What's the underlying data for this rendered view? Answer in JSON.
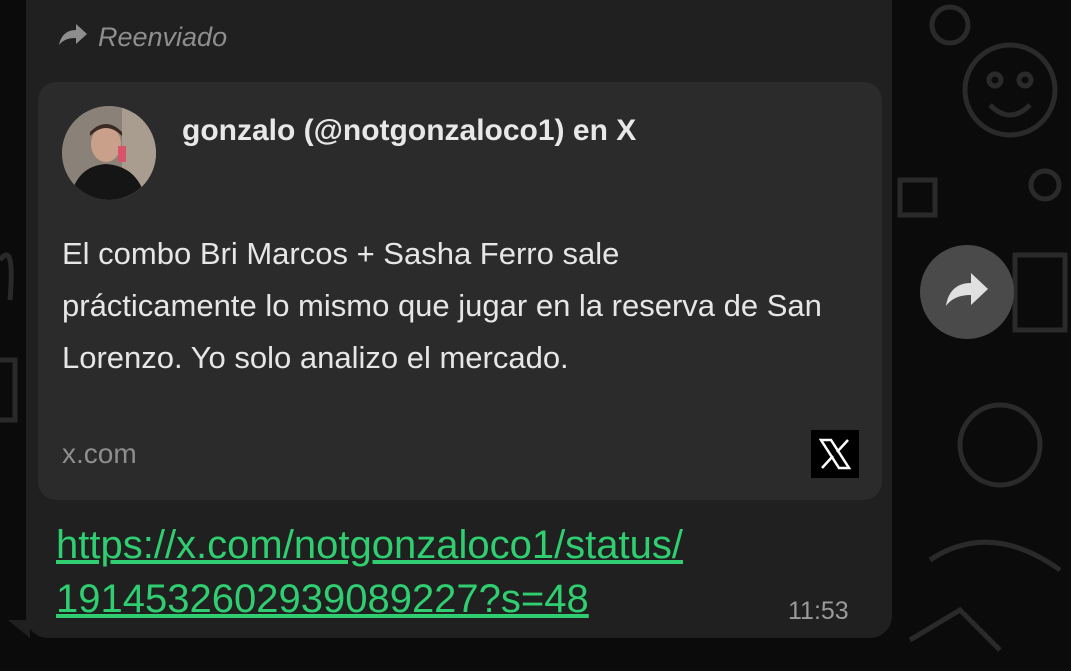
{
  "message": {
    "forwarded_label": "Reenviado",
    "preview": {
      "title": "gonzalo (@notgonzaloco1) en X",
      "description": "El combo Bri Marcos + Sasha Ferro sale prácticamente lo mismo que jugar en la reserva de San Lorenzo. Yo solo analizo el mercado.",
      "domain": "x.com"
    },
    "link_line1": "https://x.com/notgonzaloco1/status/",
    "link_line2": "1914532602939089227?s=48",
    "time": "11:53"
  },
  "icons": {
    "forward": "forward-arrow-icon",
    "share": "share-arrow-icon",
    "site_logo": "x-logo-icon"
  },
  "colors": {
    "bubble": "#202020",
    "preview_card": "#2b2b2b",
    "link": "#2fcf71",
    "muted": "#8e8e8e"
  }
}
